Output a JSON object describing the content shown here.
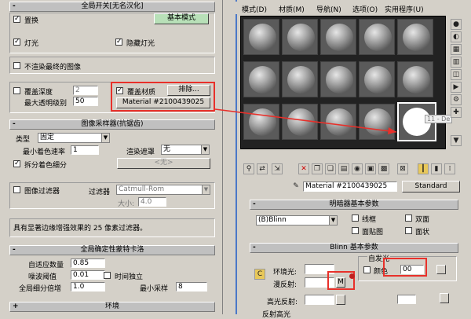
{
  "left": {
    "global_switch": {
      "title": "全局开关[无名汉化]"
    },
    "displace": {
      "label": "置换",
      "checked": true
    },
    "basic_mode_btn": "基本模式",
    "lights": {
      "label": "灯光",
      "checked": true
    },
    "hidden_lights": {
      "label": "隐藏灯光",
      "checked": true
    },
    "dont_render_final": {
      "label": "不渲染最终的图像",
      "checked": false
    },
    "override_depth": {
      "label": "覆盖深度",
      "value": "2"
    },
    "max_transp_level": {
      "label": "最大透明级别",
      "value": "50"
    },
    "override_mtl": {
      "label": "覆盖材质",
      "checked": true
    },
    "exclude_btn": "排除...",
    "override_mtl_name": "Material #2100439025",
    "image_sampler": {
      "title": "图像采样器(抗锯齿)"
    },
    "type": {
      "label": "类型",
      "value": "固定"
    },
    "min_shading_rate": {
      "label": "最小着色速率",
      "value": "1"
    },
    "render_mask": {
      "label": "渲染遮罩",
      "value": "无"
    },
    "split_shading": {
      "label": "拆分着色细分",
      "checked": true
    },
    "none_btn": "<无>",
    "image_filter": {
      "label": "图像过滤器",
      "checked": false
    },
    "filter": {
      "label": "过滤器",
      "value": "Catmull-Rom"
    },
    "size": {
      "label": "大小:",
      "value": "4.0"
    },
    "filter_desc": "具有显著边缘增强效果的 25 像素过滤器。",
    "global_dmc": {
      "title": "全局确定性蒙特卡洛"
    },
    "adaptive_amount": {
      "label": "自适应数量",
      "value": "0.85"
    },
    "noise_threshold": {
      "label": "噪波阈值",
      "value": "0.01"
    },
    "time_independent": {
      "label": "时间独立",
      "checked": false
    },
    "global_subdiv_mult": {
      "label": "全局细分倍增",
      "value": "1.0"
    },
    "min_samples": {
      "label": "最小采样",
      "value": "8"
    },
    "environment": {
      "title": "环境"
    }
  },
  "right": {
    "menu": [
      "模式(D)",
      "材质(M)",
      "导航(N)",
      "选项(O)",
      "实用程序(U)"
    ],
    "slot_label": "11 - De",
    "material_name": "Material #2100439025",
    "material_type": "Standard",
    "shader_basic": {
      "title": "明暗器基本参数"
    },
    "shader": "(B)Blinn",
    "wire": "线框",
    "two_sided": "双面",
    "face_map": "面贴图",
    "faceted": "面状",
    "blinn_basic": {
      "title": "Blinn 基本参数"
    },
    "self_illum": "自发光",
    "color": "颜色",
    "self_illum_value": "00",
    "ambient": "环境光:",
    "diffuse": "漫反射:",
    "specular": "高光反射:",
    "map_btn": "M",
    "reflect_hl": "反射高光"
  },
  "colors": {
    "highlight": "#e8302a",
    "panel": "#d4d0c8"
  }
}
